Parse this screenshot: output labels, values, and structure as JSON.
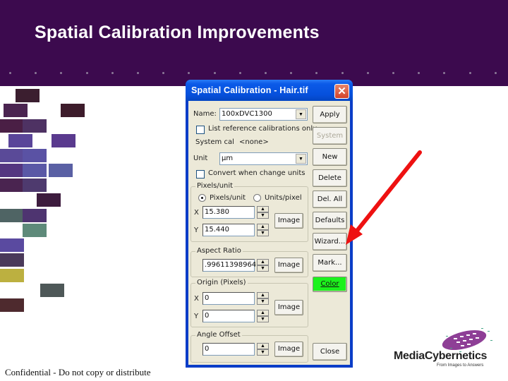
{
  "slide": {
    "title": "Spatial Calibration Improvements",
    "footer": "Confidential - Do not copy or distribute",
    "header_color": "#3c0a4e"
  },
  "dialog": {
    "title": "Spatial Calibration - Hair.tif",
    "name_label": "Name:",
    "name_value": "100xDVC1300",
    "list_reference_label": "List reference calibrations only",
    "system_cal_label": "System cal",
    "system_cal_value": "<none>",
    "unit_label": "Unit",
    "unit_value": "µm",
    "convert_label": "Convert when change units",
    "pixels_unit_group": {
      "label": "Pixels/unit",
      "radio_pixels_unit": "Pixels/unit",
      "radio_units_pixel": "Units/pixel",
      "selected": "Pixels/unit",
      "x_label": "X",
      "x_value": "15.380",
      "y_label": "Y",
      "y_value": "15.440",
      "image_button": "Image"
    },
    "aspect_ratio_group": {
      "label": "Aspect Ratio",
      "value": ".99611398964",
      "image_button": "Image"
    },
    "origin_group": {
      "label": "Origin (Pixels)",
      "x_label": "X",
      "x_value": "0",
      "y_label": "Y",
      "y_value": "0",
      "image_button": "Image"
    },
    "angle_group": {
      "label": "Angle Offset",
      "value": "0",
      "image_button": "Image"
    },
    "buttons": {
      "apply": "Apply",
      "system": "System",
      "new": "New",
      "delete": "Delete",
      "del_all": "Del. All",
      "defaults": "Defaults",
      "wizard": "Wizard...",
      "mark": "Mark...",
      "color": "Color",
      "close": "Close"
    },
    "color_swatch": "#1cf21c"
  },
  "annotation": {
    "arrow_color": "#ee1111",
    "points_to": "Wizard..."
  },
  "logo": {
    "name": "MediaCybernetics",
    "tagline": "From Images to Answers"
  }
}
